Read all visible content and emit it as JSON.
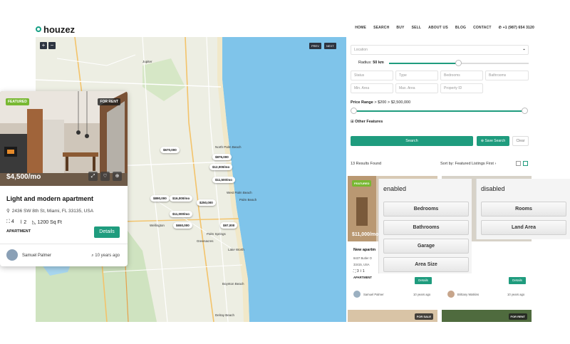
{
  "header": {
    "logo": "houzez",
    "nav": [
      "HOME",
      "SEARCH",
      "BUY",
      "SELL",
      "ABOUT US",
      "BLOG",
      "CONTACT"
    ],
    "phone": "+1 (987) 654 3120"
  },
  "map": {
    "zoom_in": "+",
    "zoom_out": "−",
    "prev": "PREV",
    "next": "NEXT",
    "places": [
      "North Palm Beach",
      "West Palm Beach",
      "Palm Beach",
      "Wellington",
      "Palm Springs",
      "Greenacres",
      "Lake Worth",
      "Boynton Beach",
      "Delray Beach",
      "Jupiter"
    ],
    "price_pins": [
      "$670,000",
      "$876,000",
      "$12,000/mo",
      "$11,500/mo",
      "$890,000",
      "$16,000/mo",
      "$250,000",
      "$11,000/mo",
      "$650,000",
      "$97,000"
    ]
  },
  "featured_card": {
    "badge": "FEATURED",
    "status": "FOR RENT",
    "price": "$4,500/mo",
    "title": "Light and modern apartment",
    "address": "2436 SW 8th St, Miami, FL 33135, USA",
    "beds": "4",
    "baths": "2",
    "area": "1200 Sq Ft",
    "type": "APARTMENT",
    "details_label": "Details",
    "agent": "Samuel Palmer",
    "age": "10 years ago"
  },
  "search": {
    "location_placeholder": "Location",
    "radius_label": "Radius:",
    "radius_value": "50 km",
    "status": "Status",
    "type": "Type",
    "bedrooms": "Bedrooms",
    "bathrooms": "Bathrooms",
    "min_area": "Min. Area",
    "max_area": "Max. Area",
    "property_id": "Property ID",
    "price_range_label": "Price Range",
    "price_min": "$200",
    "price_max": "$2,500,000",
    "other_features": "Other Features",
    "search_button": "Search",
    "save_button": "Save Search",
    "clear_button": "Clear",
    "results": "13 Results Found",
    "sort_label": "Sort by:",
    "sort_value": "Featured Listings First"
  },
  "listing": {
    "badge": "FEATURED",
    "price": "$11,000/mo",
    "title": "New apartm",
    "address": "8437 Butler O",
    "zip": "33415, USA",
    "beds": "3",
    "baths": "1",
    "type": "APARTMENT",
    "details": "Details",
    "agent1": "Samuel Palmer",
    "age1": "10 years ago",
    "agent2": "Brittany Watkins",
    "age2": "10 years ago",
    "bottom_badge1": "FOR SALE",
    "bottom_badge2": "FOR RENT"
  },
  "overlay_enabled": {
    "title": "enabled",
    "items": [
      "Bedrooms",
      "Bathrooms",
      "Garage",
      "Area Size"
    ]
  },
  "overlay_disabled": {
    "title": "disabled",
    "items": [
      "Rooms",
      "Land Area"
    ]
  },
  "colors": {
    "accent": "#1f9c7e",
    "featured": "#78b832",
    "water": "#7fc4ea"
  }
}
